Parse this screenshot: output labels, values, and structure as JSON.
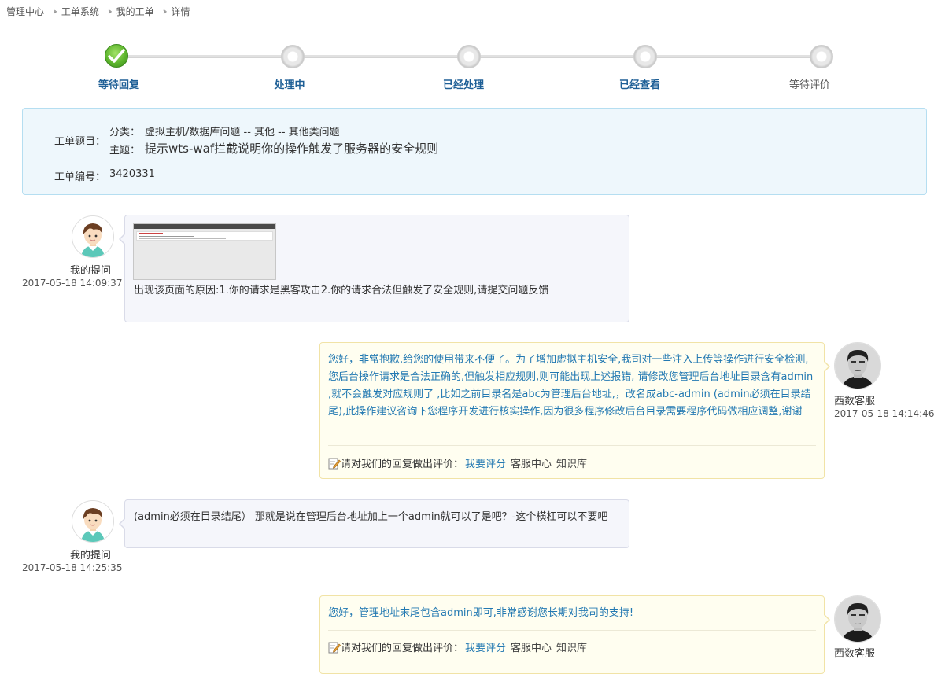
{
  "breadcrumb": [
    "管理中心",
    "工单系统",
    "我的工单",
    "详情"
  ],
  "steps": [
    {
      "label": "等待回复",
      "state": "done"
    },
    {
      "label": "处理中",
      "state": "active"
    },
    {
      "label": "已经处理",
      "state": "active"
    },
    {
      "label": "已经查看",
      "state": "active"
    },
    {
      "label": "等待评价",
      "state": "pending"
    }
  ],
  "ticket": {
    "title_label": "工单题目：",
    "category_label": "分类：",
    "category_value": "虚拟主机/数据库问题 -- 其他 -- 其他类问题",
    "subject_label": "主题：",
    "subject_value": "提示wts-waf拦截说明你的操作触发了服务器的安全规则",
    "number_label": "工单编号：",
    "number_value": "3420331"
  },
  "messages": [
    {
      "role": "question",
      "author": "我的提问",
      "time": "2017-05-18 14:09:37",
      "text": "出现该页面的原因:1.你的请求是黑客攻击2.你的请求合法但触发了安全规则,请提交问题反馈",
      "has_image": true
    },
    {
      "role": "answer",
      "author": "西数客服",
      "time": "2017-05-18 14:14:46",
      "text": "您好，非常抱歉,给您的使用带来不便了。为了增加虚拟主机安全,我司对一些注入上传等操作进行安全检测,您后台操作请求是合法正确的,但触发相应规则,则可能出现上述报错, 请修改您管理后台地址目录含有admin ,就不会触发对应规则了 ,比如之前目录名是abc为管理后台地址,，改名成abc-admin (admin必须在目录结尾),此操作建议咨询下您程序开发进行核实操作,因为很多程序修改后台目录需要程序代码做相应调整,谢谢"
    },
    {
      "role": "question",
      "author": "我的提问",
      "time": "2017-05-18 14:25:35",
      "text": "(admin必须在目录结尾） 那就是说在管理后台地址加上一个admin就可以了是吧？-这个横杠可以不要吧"
    },
    {
      "role": "answer",
      "author": "西数客服",
      "time": "",
      "text": "您好，管理地址末尾包含admin即可,非常感谢您长期对我司的支持!"
    }
  ],
  "rating": {
    "prompt": "请对我们的回复做出评价：",
    "rate_link": "我要评分",
    "service_link": "客服中心",
    "kb_link": "知识库"
  },
  "colors": {
    "accent": "#1e5f96",
    "answer_text": "#2379b2",
    "info_bg": "#eef7fc",
    "answer_bg": "#fffef0"
  }
}
